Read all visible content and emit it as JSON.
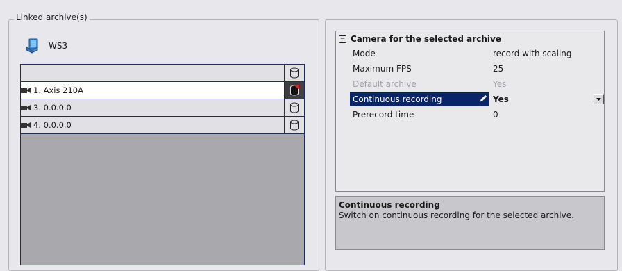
{
  "linked_archives": {
    "legend": "Linked archive(s)",
    "server": {
      "name": "WS3",
      "icon": "server-computer-icon"
    },
    "rows": [
      {
        "label": "",
        "status_icon": "archive-cylinder-icon",
        "selected": false
      },
      {
        "label": "1. Axis 210A",
        "status_icon": "archive-recording-icon",
        "selected": true
      },
      {
        "label": "3. 0.0.0.0",
        "status_icon": "archive-cylinder-icon",
        "selected": false
      },
      {
        "label": "4. 0.0.0.0",
        "status_icon": "archive-cylinder-icon",
        "selected": false
      }
    ]
  },
  "property_grid": {
    "category": "Camera for the selected archive",
    "collapse_symbol": "−",
    "properties": [
      {
        "name": "Mode",
        "value": "record with scaling"
      },
      {
        "name": "Maximum FPS",
        "value": "25"
      },
      {
        "name": "Default archive",
        "value": "Yes"
      },
      {
        "name": "Continuous recording",
        "value": "Yes"
      },
      {
        "name": "Prerecord time",
        "value": "0"
      }
    ]
  },
  "description": {
    "title": "Continuous recording",
    "text": "Switch on continuous recording for the selected archive."
  },
  "colors": {
    "selection": "#0a246a",
    "grid_border": "#1f2e56",
    "panel_bg": "#e8e8ec"
  }
}
